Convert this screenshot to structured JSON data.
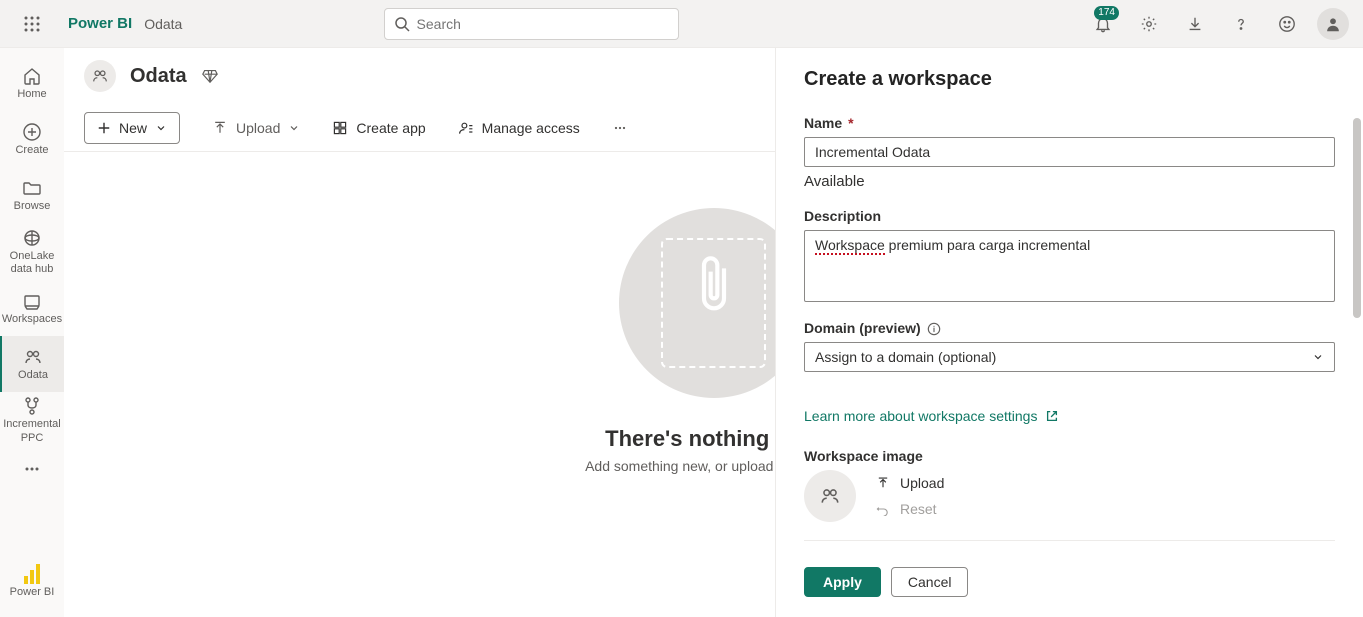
{
  "header": {
    "brand": "Power BI",
    "breadcrumb": "Odata",
    "search_placeholder": "Search",
    "notification_count": "174"
  },
  "rail": {
    "home": "Home",
    "create": "Create",
    "browse": "Browse",
    "onelake": "OneLake data hub",
    "workspaces": "Workspaces",
    "odata": "Odata",
    "incremental": "Incremental PPC",
    "power_bi": "Power BI"
  },
  "workspace": {
    "title": "Odata"
  },
  "toolbar": {
    "new": "New",
    "upload": "Upload",
    "create_app": "Create app",
    "manage_access": "Manage access"
  },
  "empty": {
    "title": "There's nothing here",
    "subtitle": "Add something new, or upload something"
  },
  "panel": {
    "title": "Create a workspace",
    "name_label": "Name",
    "name_value": "Incremental Odata",
    "available_msg": "Available",
    "desc_label": "Description",
    "desc_spelled": "Workspace",
    "desc_rest": " premium para carga incremental",
    "domain_label": "Domain (preview)",
    "domain_placeholder": "Assign to a domain (optional)",
    "learn_link": "Learn more about workspace settings",
    "ws_image_label": "Workspace image",
    "upload_action": "Upload",
    "reset_action": "Reset",
    "apply": "Apply",
    "cancel": "Cancel"
  }
}
